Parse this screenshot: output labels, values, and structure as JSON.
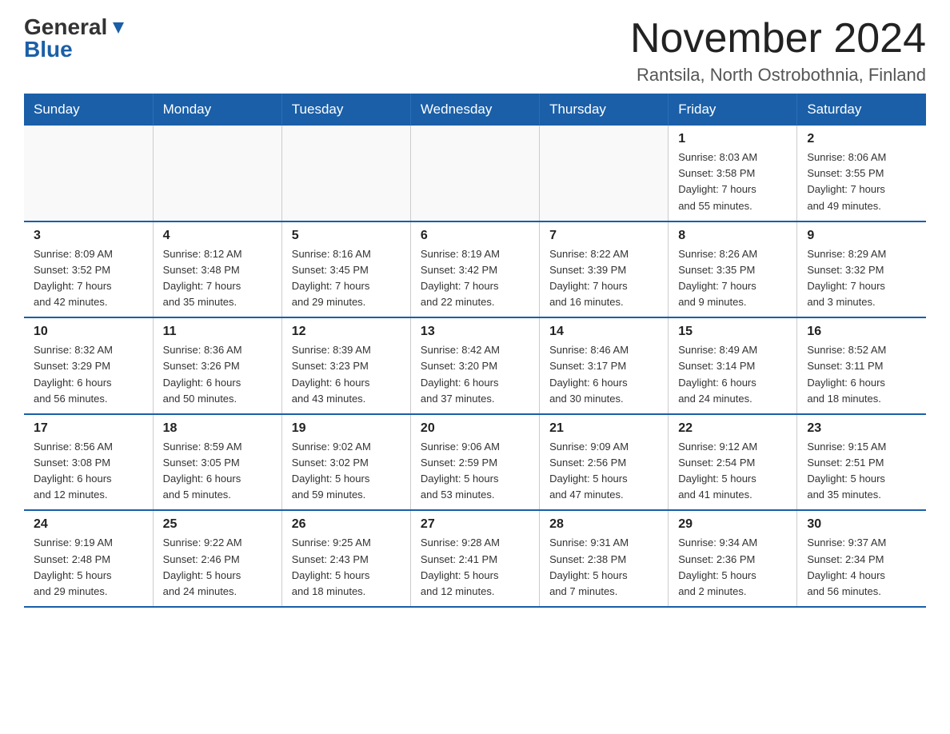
{
  "header": {
    "logo_general": "General",
    "logo_blue": "Blue",
    "main_title": "November 2024",
    "subtitle": "Rantsila, North Ostrobothnia, Finland"
  },
  "weekdays": [
    "Sunday",
    "Monday",
    "Tuesday",
    "Wednesday",
    "Thursday",
    "Friday",
    "Saturday"
  ],
  "weeks": [
    [
      {
        "day": "",
        "info": ""
      },
      {
        "day": "",
        "info": ""
      },
      {
        "day": "",
        "info": ""
      },
      {
        "day": "",
        "info": ""
      },
      {
        "day": "",
        "info": ""
      },
      {
        "day": "1",
        "info": "Sunrise: 8:03 AM\nSunset: 3:58 PM\nDaylight: 7 hours\nand 55 minutes."
      },
      {
        "day": "2",
        "info": "Sunrise: 8:06 AM\nSunset: 3:55 PM\nDaylight: 7 hours\nand 49 minutes."
      }
    ],
    [
      {
        "day": "3",
        "info": "Sunrise: 8:09 AM\nSunset: 3:52 PM\nDaylight: 7 hours\nand 42 minutes."
      },
      {
        "day": "4",
        "info": "Sunrise: 8:12 AM\nSunset: 3:48 PM\nDaylight: 7 hours\nand 35 minutes."
      },
      {
        "day": "5",
        "info": "Sunrise: 8:16 AM\nSunset: 3:45 PM\nDaylight: 7 hours\nand 29 minutes."
      },
      {
        "day": "6",
        "info": "Sunrise: 8:19 AM\nSunset: 3:42 PM\nDaylight: 7 hours\nand 22 minutes."
      },
      {
        "day": "7",
        "info": "Sunrise: 8:22 AM\nSunset: 3:39 PM\nDaylight: 7 hours\nand 16 minutes."
      },
      {
        "day": "8",
        "info": "Sunrise: 8:26 AM\nSunset: 3:35 PM\nDaylight: 7 hours\nand 9 minutes."
      },
      {
        "day": "9",
        "info": "Sunrise: 8:29 AM\nSunset: 3:32 PM\nDaylight: 7 hours\nand 3 minutes."
      }
    ],
    [
      {
        "day": "10",
        "info": "Sunrise: 8:32 AM\nSunset: 3:29 PM\nDaylight: 6 hours\nand 56 minutes."
      },
      {
        "day": "11",
        "info": "Sunrise: 8:36 AM\nSunset: 3:26 PM\nDaylight: 6 hours\nand 50 minutes."
      },
      {
        "day": "12",
        "info": "Sunrise: 8:39 AM\nSunset: 3:23 PM\nDaylight: 6 hours\nand 43 minutes."
      },
      {
        "day": "13",
        "info": "Sunrise: 8:42 AM\nSunset: 3:20 PM\nDaylight: 6 hours\nand 37 minutes."
      },
      {
        "day": "14",
        "info": "Sunrise: 8:46 AM\nSunset: 3:17 PM\nDaylight: 6 hours\nand 30 minutes."
      },
      {
        "day": "15",
        "info": "Sunrise: 8:49 AM\nSunset: 3:14 PM\nDaylight: 6 hours\nand 24 minutes."
      },
      {
        "day": "16",
        "info": "Sunrise: 8:52 AM\nSunset: 3:11 PM\nDaylight: 6 hours\nand 18 minutes."
      }
    ],
    [
      {
        "day": "17",
        "info": "Sunrise: 8:56 AM\nSunset: 3:08 PM\nDaylight: 6 hours\nand 12 minutes."
      },
      {
        "day": "18",
        "info": "Sunrise: 8:59 AM\nSunset: 3:05 PM\nDaylight: 6 hours\nand 5 minutes."
      },
      {
        "day": "19",
        "info": "Sunrise: 9:02 AM\nSunset: 3:02 PM\nDaylight: 5 hours\nand 59 minutes."
      },
      {
        "day": "20",
        "info": "Sunrise: 9:06 AM\nSunset: 2:59 PM\nDaylight: 5 hours\nand 53 minutes."
      },
      {
        "day": "21",
        "info": "Sunrise: 9:09 AM\nSunset: 2:56 PM\nDaylight: 5 hours\nand 47 minutes."
      },
      {
        "day": "22",
        "info": "Sunrise: 9:12 AM\nSunset: 2:54 PM\nDaylight: 5 hours\nand 41 minutes."
      },
      {
        "day": "23",
        "info": "Sunrise: 9:15 AM\nSunset: 2:51 PM\nDaylight: 5 hours\nand 35 minutes."
      }
    ],
    [
      {
        "day": "24",
        "info": "Sunrise: 9:19 AM\nSunset: 2:48 PM\nDaylight: 5 hours\nand 29 minutes."
      },
      {
        "day": "25",
        "info": "Sunrise: 9:22 AM\nSunset: 2:46 PM\nDaylight: 5 hours\nand 24 minutes."
      },
      {
        "day": "26",
        "info": "Sunrise: 9:25 AM\nSunset: 2:43 PM\nDaylight: 5 hours\nand 18 minutes."
      },
      {
        "day": "27",
        "info": "Sunrise: 9:28 AM\nSunset: 2:41 PM\nDaylight: 5 hours\nand 12 minutes."
      },
      {
        "day": "28",
        "info": "Sunrise: 9:31 AM\nSunset: 2:38 PM\nDaylight: 5 hours\nand 7 minutes."
      },
      {
        "day": "29",
        "info": "Sunrise: 9:34 AM\nSunset: 2:36 PM\nDaylight: 5 hours\nand 2 minutes."
      },
      {
        "day": "30",
        "info": "Sunrise: 9:37 AM\nSunset: 2:34 PM\nDaylight: 4 hours\nand 56 minutes."
      }
    ]
  ]
}
